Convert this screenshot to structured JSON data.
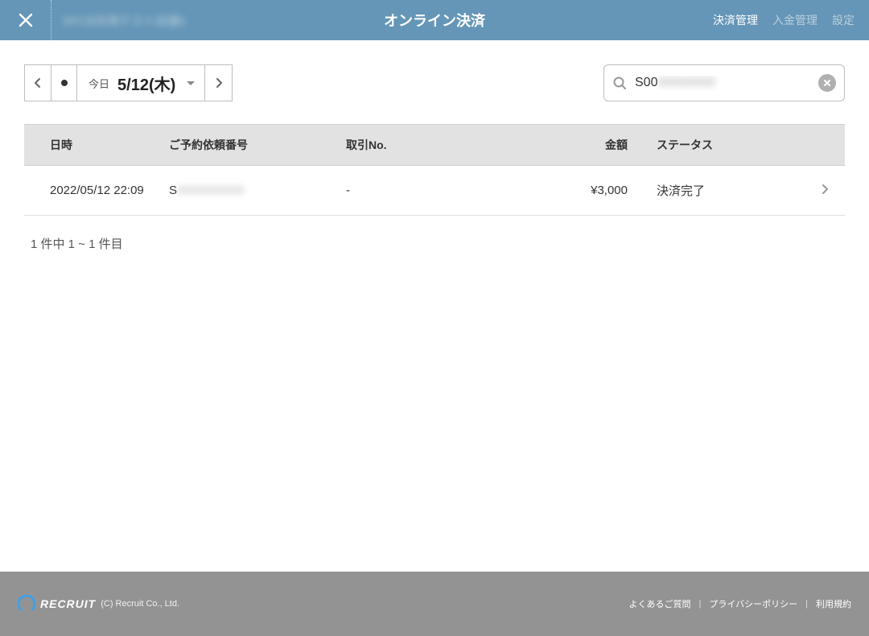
{
  "header": {
    "store_name": "SFCB共用テスト店舗1",
    "title": "オンライン決済",
    "nav": {
      "payment": "決済管理",
      "deposit": "入金管理",
      "settings": "設定"
    }
  },
  "date_picker": {
    "today_label": "今日",
    "date_text": "5/12(木)"
  },
  "search": {
    "value_visible": "S00",
    "value_masked": "00000000"
  },
  "table": {
    "headers": {
      "datetime": "日時",
      "request_no": "ご予約依頼番号",
      "txn_no": "取引No.",
      "amount": "金額",
      "status": "ステータス"
    },
    "rows": [
      {
        "datetime": "2022/05/12 22:09",
        "request_prefix": "S",
        "request_masked": "0000000000",
        "txn_no": "-",
        "amount": "¥3,000",
        "status": "決済完了"
      }
    ]
  },
  "pagination": "1 件中 1 ~ 1 件目",
  "footer": {
    "brand": "RECRUIT",
    "copyright": "(C) Recruit Co., Ltd.",
    "links": {
      "faq": "よくあるご質問",
      "privacy": "プライバシーポリシー",
      "terms": "利用規約"
    }
  }
}
